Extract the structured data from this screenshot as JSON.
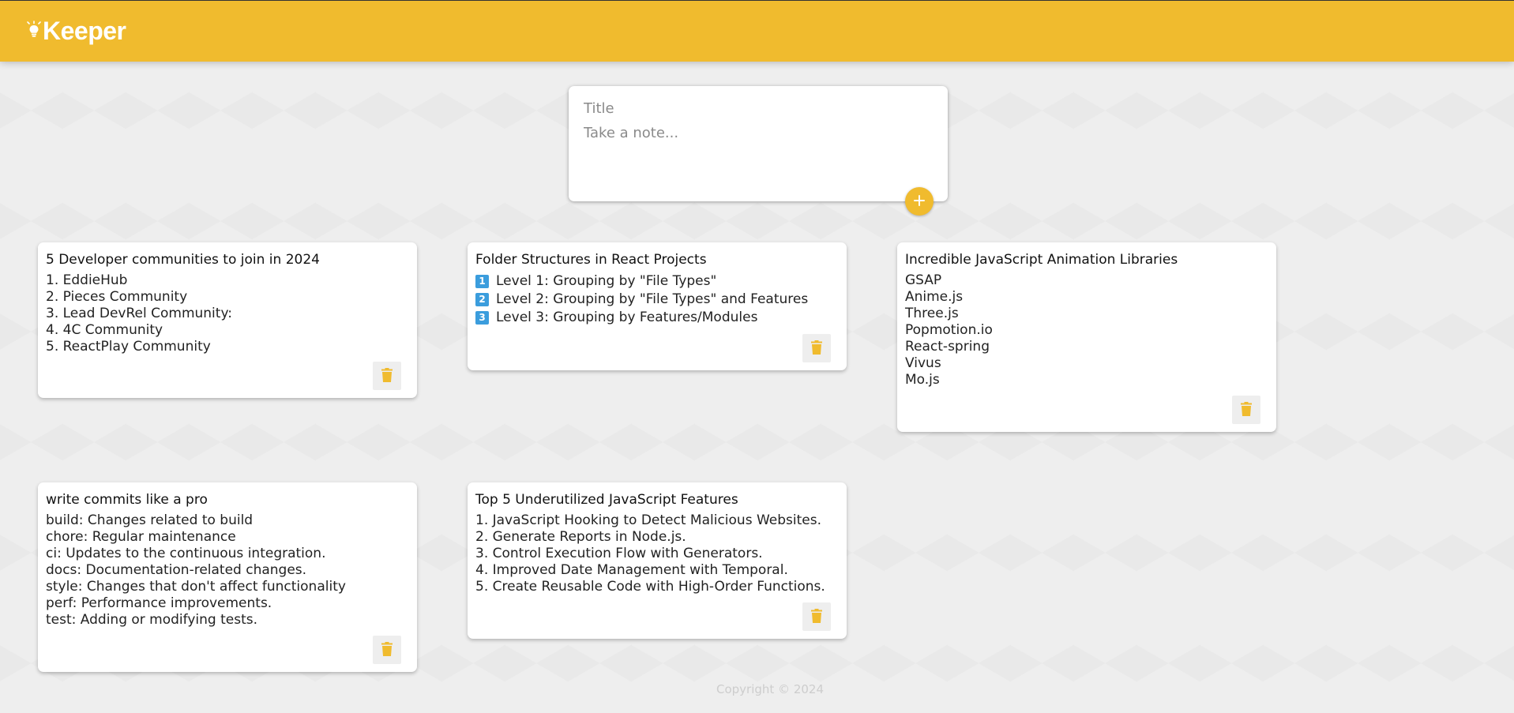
{
  "header": {
    "app_name": "Keeper",
    "logo_icon": "lightbulb-icon"
  },
  "create_note": {
    "title_placeholder": "Title",
    "content_placeholder": "Take a note...",
    "add_icon": "plus-icon"
  },
  "notes": [
    {
      "title": "5 Developer communities to join in 2024",
      "lines": [
        "1. EddieHub",
        "2. Pieces Community",
        "3. Lead DevRel Community:",
        "4. 4C Community",
        "5. ReactPlay Community"
      ],
      "delete_icon": "trash-icon"
    },
    {
      "title": "Folder Structures in React Projects",
      "lines": [
        {
          "badge": "1",
          "text": "Level 1: Grouping by \"File Types\""
        },
        {
          "badge": "2",
          "text": "Level 2: Grouping by \"File Types\" and Features"
        },
        {
          "badge": "3",
          "text": "Level 3: Grouping by Features/Modules"
        }
      ],
      "delete_icon": "trash-icon"
    },
    {
      "title": "Incredible JavaScript Animation Libraries",
      "lines": [
        "GSAP",
        "Anime.js",
        "Three.js",
        "Popmotion.io",
        "React-spring",
        "Vivus",
        "Mo.js"
      ],
      "delete_icon": "trash-icon"
    },
    {
      "title": "write commits like a pro",
      "lines": [
        "build: Changes related to build",
        "chore: Regular maintenance",
        "ci: Updates to the continuous integration.",
        "docs: Documentation-related changes.",
        "style: Changes that don't affect functionality",
        "perf: Performance improvements.",
        "test: Adding or modifying tests."
      ],
      "delete_icon": "trash-icon"
    },
    {
      "title": "Top 5 Underutilized JavaScript Features",
      "lines": [
        "1. JavaScript Hooking to Detect Malicious Websites.",
        "2. Generate Reports in Node.js.",
        "3. Control Execution Flow with Generators.",
        "4. Improved Date Management with Temporal.",
        "5. Create Reusable Code with High-Order Functions."
      ],
      "delete_icon": "trash-icon"
    }
  ],
  "footer": {
    "copyright": "Copyright © 2024"
  },
  "colors": {
    "accent": "#f0bb2e",
    "badge_blue": "#3b9ddd",
    "background": "#eeeeee"
  }
}
